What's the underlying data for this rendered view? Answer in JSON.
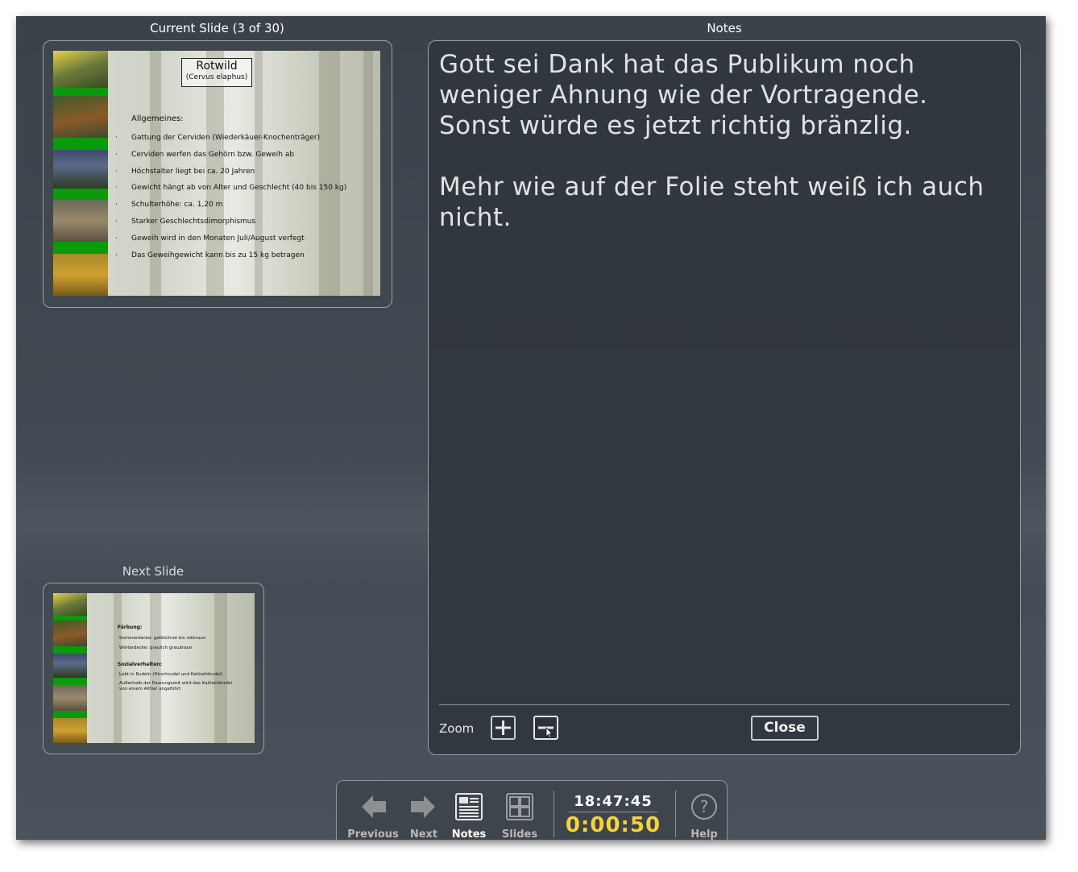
{
  "current_slide": {
    "title": "Current Slide (3 of 30)",
    "slide_heading": "Rotwild",
    "slide_subheading": "(Cervus elaphus)",
    "section": "Allgemeines:",
    "bullets": [
      "Gattung der Cerviden (Wiederkäuer-Knochenträger)",
      "Cerviden werfen das Gehörn bzw. Geweih ab",
      "Höchstalter liegt bei ca. 20 Jahren",
      "Gewicht hängt ab von Alter und Geschlecht (40 bis 150 kg)",
      "Schulterhöhe: ca. 1,20 m",
      "Starker Geschlechtsdimorphismus",
      "Geweih wird in den Monaten Juli/August verfegt",
      "Das Geweihgewicht kann bis zu 15 kg betragen"
    ]
  },
  "next_slide": {
    "title": "Next Slide",
    "section1": "Färbung:",
    "lines1": [
      "Sommerdecke: gelblichrot bis rotbraun",
      "Winterdecke: graulich graubraun"
    ],
    "section2": "Sozialverhalten:",
    "lines2": [
      "Lebt in Rudeln (Hirschrudel und Kahlwildrudel)",
      "Außerhalb der Paarungszeit wird das Kahlwildrudel",
      "von einem Alttier angeführt"
    ]
  },
  "notes": {
    "title": "Notes",
    "text": "Gott sei Dank hat das Publikum noch\nweniger Ahnung wie der Vortragende.\nSonst würde es jetzt richtig bränzlig.\n\nMehr wie auf der Folie steht weiß ich auch\nnicht.",
    "zoom_label": "Zoom",
    "close_label": "Close"
  },
  "toolbar": {
    "previous": "Previous",
    "next": "Next",
    "notes": "Notes",
    "slides": "Slides",
    "clock": "18:47:45",
    "elapsed": "0:00:50",
    "help": "Help"
  },
  "colors": {
    "elapsed_timer": "#f5d33c",
    "slide_green": "#0b9a0b",
    "background": "#3f464f"
  }
}
